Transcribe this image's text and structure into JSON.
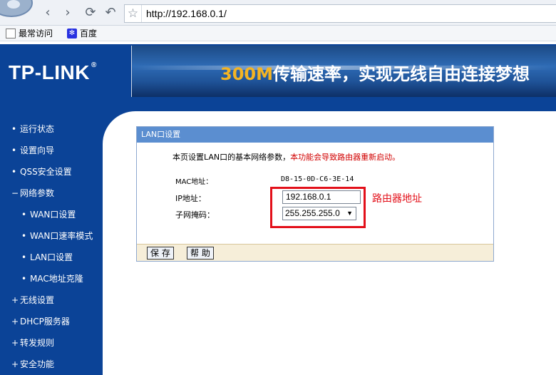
{
  "browser": {
    "url": "http://192.168.0.1/",
    "nav": {
      "back": "‹",
      "forward": "›",
      "reload": "⟳",
      "undo": "↶",
      "star": "☆"
    },
    "bookmarks": [
      "最常访问",
      "百度"
    ]
  },
  "header": {
    "brand": "TP-LINK",
    "brand_mark": "®",
    "slogan_highlight": "300M",
    "slogan_rest": "传输速率，实现无线自由连接梦想"
  },
  "sidebar": {
    "items": [
      {
        "bullet": "•",
        "label": "运行状态"
      },
      {
        "bullet": "•",
        "label": "设置向导"
      },
      {
        "bullet": "•",
        "label": "QSS安全设置"
      },
      {
        "bullet": "−",
        "label": "网络参数"
      },
      {
        "bullet": "•",
        "label": "WAN口设置"
      },
      {
        "bullet": "•",
        "label": "WAN口速率模式"
      },
      {
        "bullet": "•",
        "label": "LAN口设置"
      },
      {
        "bullet": "•",
        "label": "MAC地址克隆"
      },
      {
        "bullet": "+",
        "label": "无线设置"
      },
      {
        "bullet": "+",
        "label": "DHCP服务器"
      },
      {
        "bullet": "+",
        "label": "转发规则"
      },
      {
        "bullet": "+",
        "label": "安全功能"
      }
    ]
  },
  "panel": {
    "title": "LAN口设置",
    "desc_normal": "本页设置LAN口的基本网络参数，",
    "desc_warning": "本功能会导致路由器重新启动。",
    "mac_label": "MAC地址：",
    "mac_value": "D8-15-0D-C6-3E-14",
    "ip_label": "IP地址：",
    "ip_value": "192.168.0.1",
    "mask_label": "子网掩码：",
    "mask_value": "255.255.255.0",
    "annotation": "路由器地址",
    "save_label": "保 存",
    "help_label": "帮 助"
  },
  "colors": {
    "brand_blue": "#0b4397",
    "panel_title": "#5b8ed0",
    "warning": "#d10000",
    "highlight": "#e3101a",
    "slogan_accent": "#f4b423"
  }
}
